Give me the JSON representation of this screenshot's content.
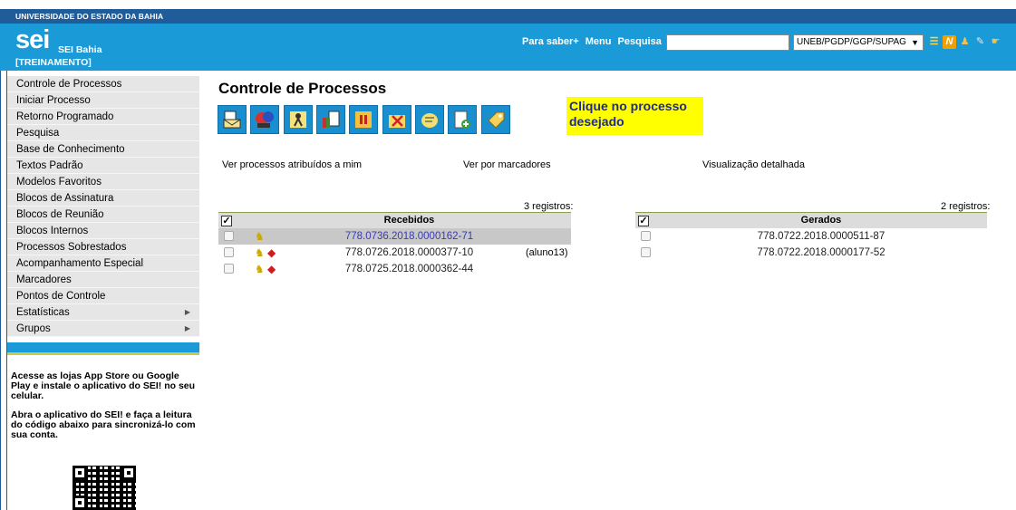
{
  "header": {
    "org_name": "UNIVERSIDADE DO ESTADO DA BAHIA",
    "logo": "sei",
    "app_name": "SEI Bahia",
    "env_label": "[TREINAMENTO]",
    "link_saber": "Para saber+",
    "link_menu": "Menu",
    "link_pesquisa": "Pesquisa",
    "search_value": "",
    "unit_selected": "UNEB/PGDP/GGP/SUPAG",
    "icons": [
      "list-icon",
      "notes-icon",
      "user-icon",
      "tools-icon",
      "hand-icon"
    ],
    "colors": {
      "top_bar": "#1f5c99",
      "header": "#1a9ad6"
    }
  },
  "sidebar": {
    "items": [
      {
        "label": "Controle de Processos"
      },
      {
        "label": "Iniciar Processo"
      },
      {
        "label": "Retorno Programado"
      },
      {
        "label": "Pesquisa"
      },
      {
        "label": "Base de Conhecimento"
      },
      {
        "label": "Textos Padrão"
      },
      {
        "label": "Modelos Favoritos"
      },
      {
        "label": "Blocos de Assinatura"
      },
      {
        "label": "Blocos de Reunião"
      },
      {
        "label": "Blocos Internos"
      },
      {
        "label": "Processos Sobrestados"
      },
      {
        "label": "Acompanhamento Especial"
      },
      {
        "label": "Marcadores"
      },
      {
        "label": "Pontos de Controle"
      },
      {
        "label": "Estatísticas",
        "submenu": true
      },
      {
        "label": "Grupos",
        "submenu": true
      }
    ],
    "promo_1": "Acesse as lojas App Store ou Google Play e instale o aplicativo do SEI! no seu celular.",
    "promo_2": "Abra o aplicativo do SEI! e faça a leitura do código abaixo para sincronizá-lo com sua conta."
  },
  "main": {
    "title": "Controle de Processos",
    "toolbar_icons": [
      "send-process-icon",
      "process-tree-icon",
      "assign-user-icon",
      "documents-icon",
      "pause-icon",
      "close-process-icon",
      "notes-icon",
      "new-document-icon",
      "tag-icon"
    ],
    "callout": "Clique no processo desejado",
    "link_atribuidos": "Ver processos atribuídos a mim",
    "link_marcadores": "Ver por marcadores",
    "link_detalhada": "Visualização detalhada",
    "recebidos": {
      "count": "3 registros:",
      "header": "Recebidos",
      "rows": [
        {
          "number": "778.0736.2018.0000162-71",
          "user": "",
          "selected": true
        },
        {
          "number": "778.0726.2018.0000377-10",
          "user": "(aluno13)",
          "selected": false
        },
        {
          "number": "778.0725.2018.0000362-44",
          "user": "",
          "selected": false
        }
      ]
    },
    "gerados": {
      "count": "2 registros:",
      "header": "Gerados",
      "rows": [
        {
          "number": "778.0722.2018.0000511-87"
        },
        {
          "number": "778.0722.2018.0000177-52"
        }
      ]
    }
  }
}
